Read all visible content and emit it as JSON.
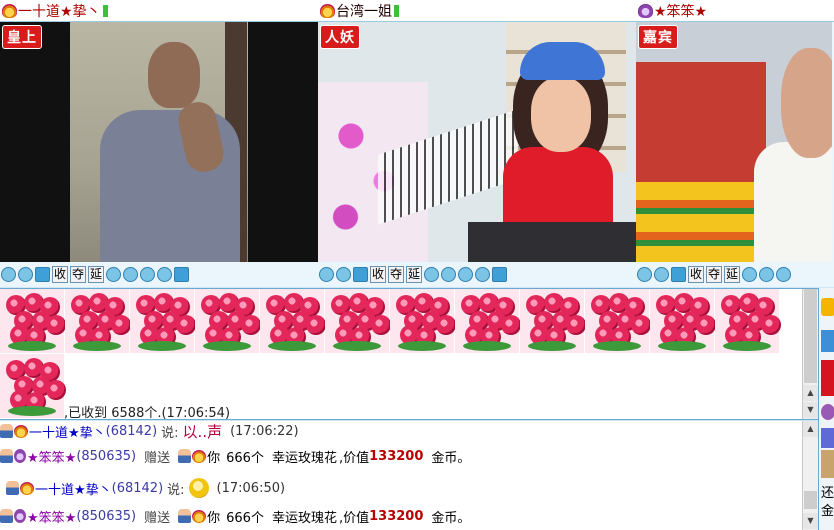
{
  "panels": [
    {
      "name": "一十道★挚丶",
      "badge": "皇上"
    },
    {
      "name": "台湾一姐",
      "badge": "人妖"
    },
    {
      "name": "★笨笨★",
      "badge": "嘉宾"
    }
  ],
  "toolbar": {
    "btn_collect": "收",
    "btn_kick": "夺",
    "btn_delay": "延"
  },
  "gift": {
    "received_text": ",已收到 6588个.(17:06:54)"
  },
  "chat": [
    {
      "user": "一十道★挚丶",
      "id": "(68142)",
      "said": "说:",
      "message": "以..声",
      "time": "(17:06:22)"
    },
    {
      "user": "★笨笨★",
      "id": "(850635)",
      "action": "赠送",
      "target": "你",
      "count": "666个",
      "item": "幸运玫瑰花",
      "price_prefix": ",价值",
      "price": "133200",
      "unit": "金币。"
    },
    {
      "user": "一十道★挚丶",
      "id": "(68142)",
      "said": "说:",
      "time": "(17:06:50)"
    },
    {
      "user": "★笨笨★",
      "id": "(850635)",
      "action": "赠送",
      "target": "你",
      "count": "666个",
      "item": "幸运玫瑰花",
      "price_prefix": ",价值",
      "price": "133200",
      "unit": "金币。"
    }
  ],
  "side": {
    "char1": "还",
    "char2": "金"
  },
  "icons": [
    "crown-icon",
    "microphone-icon",
    "rose-gift-icon",
    "emoji-icon",
    "avatar-icon",
    "settings-icon"
  ]
}
